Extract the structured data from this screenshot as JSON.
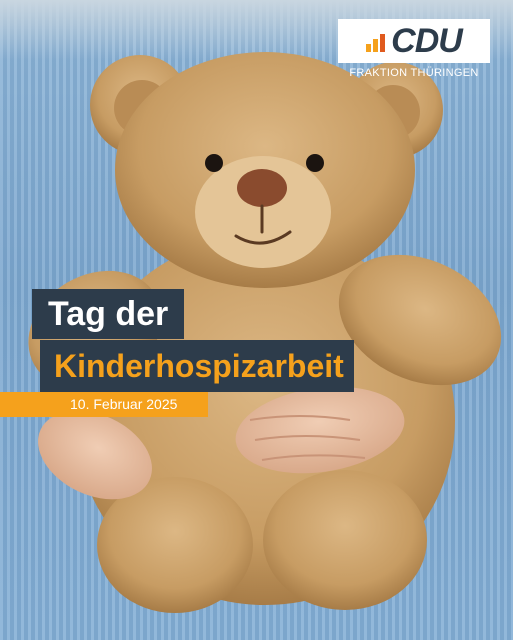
{
  "branding": {
    "logo_text": "CDU",
    "subtitle": "FRAKTION THÜRINGEN",
    "logo_bar_colors": [
      "#f5a11c",
      "#f5a11c",
      "#e05a1e",
      "#2d3c4b"
    ]
  },
  "headline": {
    "line1": "Tag der",
    "line2": "Kinderhospizarbeit"
  },
  "date": "10. Februar 2025",
  "colors": {
    "navy": "#2d3c4b",
    "orange": "#f5a11c",
    "dress_blue": "#86b0d6",
    "bear_tan": "#c9a06a"
  },
  "icons": [
    "teddy-bear-image"
  ]
}
